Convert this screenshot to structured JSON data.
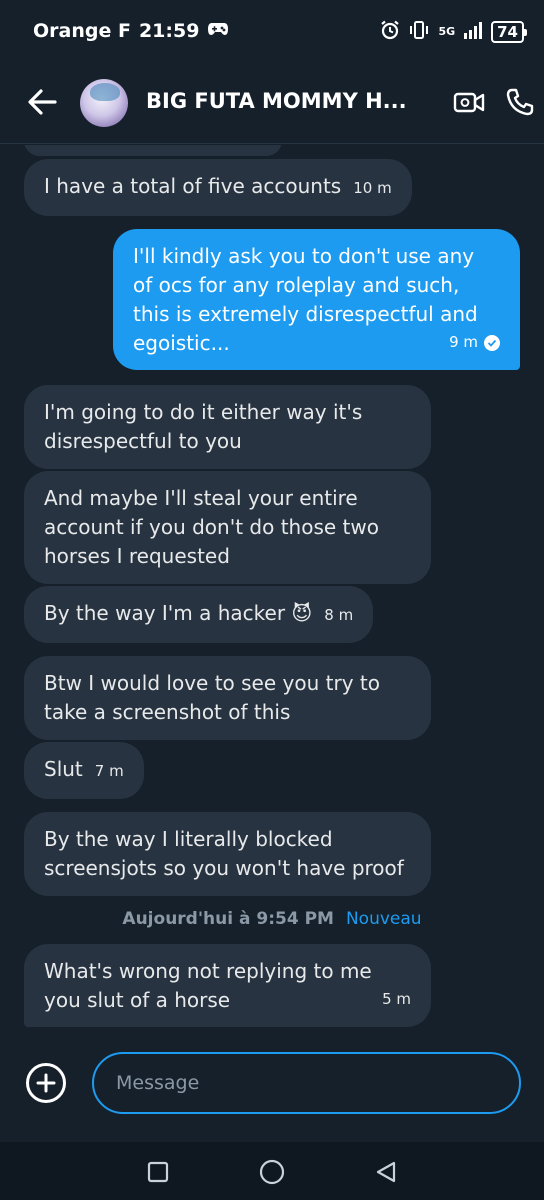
{
  "status_bar": {
    "carrier": "Orange F",
    "time": "21:59",
    "network": "5G",
    "battery": "74"
  },
  "header": {
    "contact_name": "BIG FUTA MOMMY H..."
  },
  "messages": [
    {
      "direction": "received",
      "text": "I have a total of five accounts",
      "time": "10 m"
    },
    {
      "direction": "sent",
      "text": "I'll kindly ask you to don't use any of ocs for any roleplay and such, this is extremely disrespectful and egoistic...",
      "time": "9 m"
    },
    {
      "direction": "received",
      "text": "I'm going to do it either way it's disrespectful to you",
      "time": ""
    },
    {
      "direction": "received",
      "text": "And maybe I'll steal your entire account if you don't do those two horses I requested",
      "time": ""
    },
    {
      "direction": "received",
      "text": "By the way I'm a hacker 😈",
      "time": "8 m"
    },
    {
      "direction": "received",
      "text": "Btw I would love to see you try to take a screenshot of this",
      "time": ""
    },
    {
      "direction": "received",
      "text": "Slut",
      "time": "7 m"
    },
    {
      "direction": "received",
      "text": "By the way I literally blocked screensjots so you won't have proof",
      "time": ""
    },
    {
      "direction": "received",
      "text": "What's wrong not replying to me you slut of a horse",
      "time": "5 m"
    }
  ],
  "divider": {
    "label": "Aujourd'hui à 9:54 PM",
    "new_label": "Nouveau"
  },
  "composer": {
    "placeholder": "Message"
  },
  "colors": {
    "background": "#15202b",
    "received_bubble": "#273340",
    "sent_bubble": "#1d9bf0",
    "accent": "#1d9bf0"
  }
}
